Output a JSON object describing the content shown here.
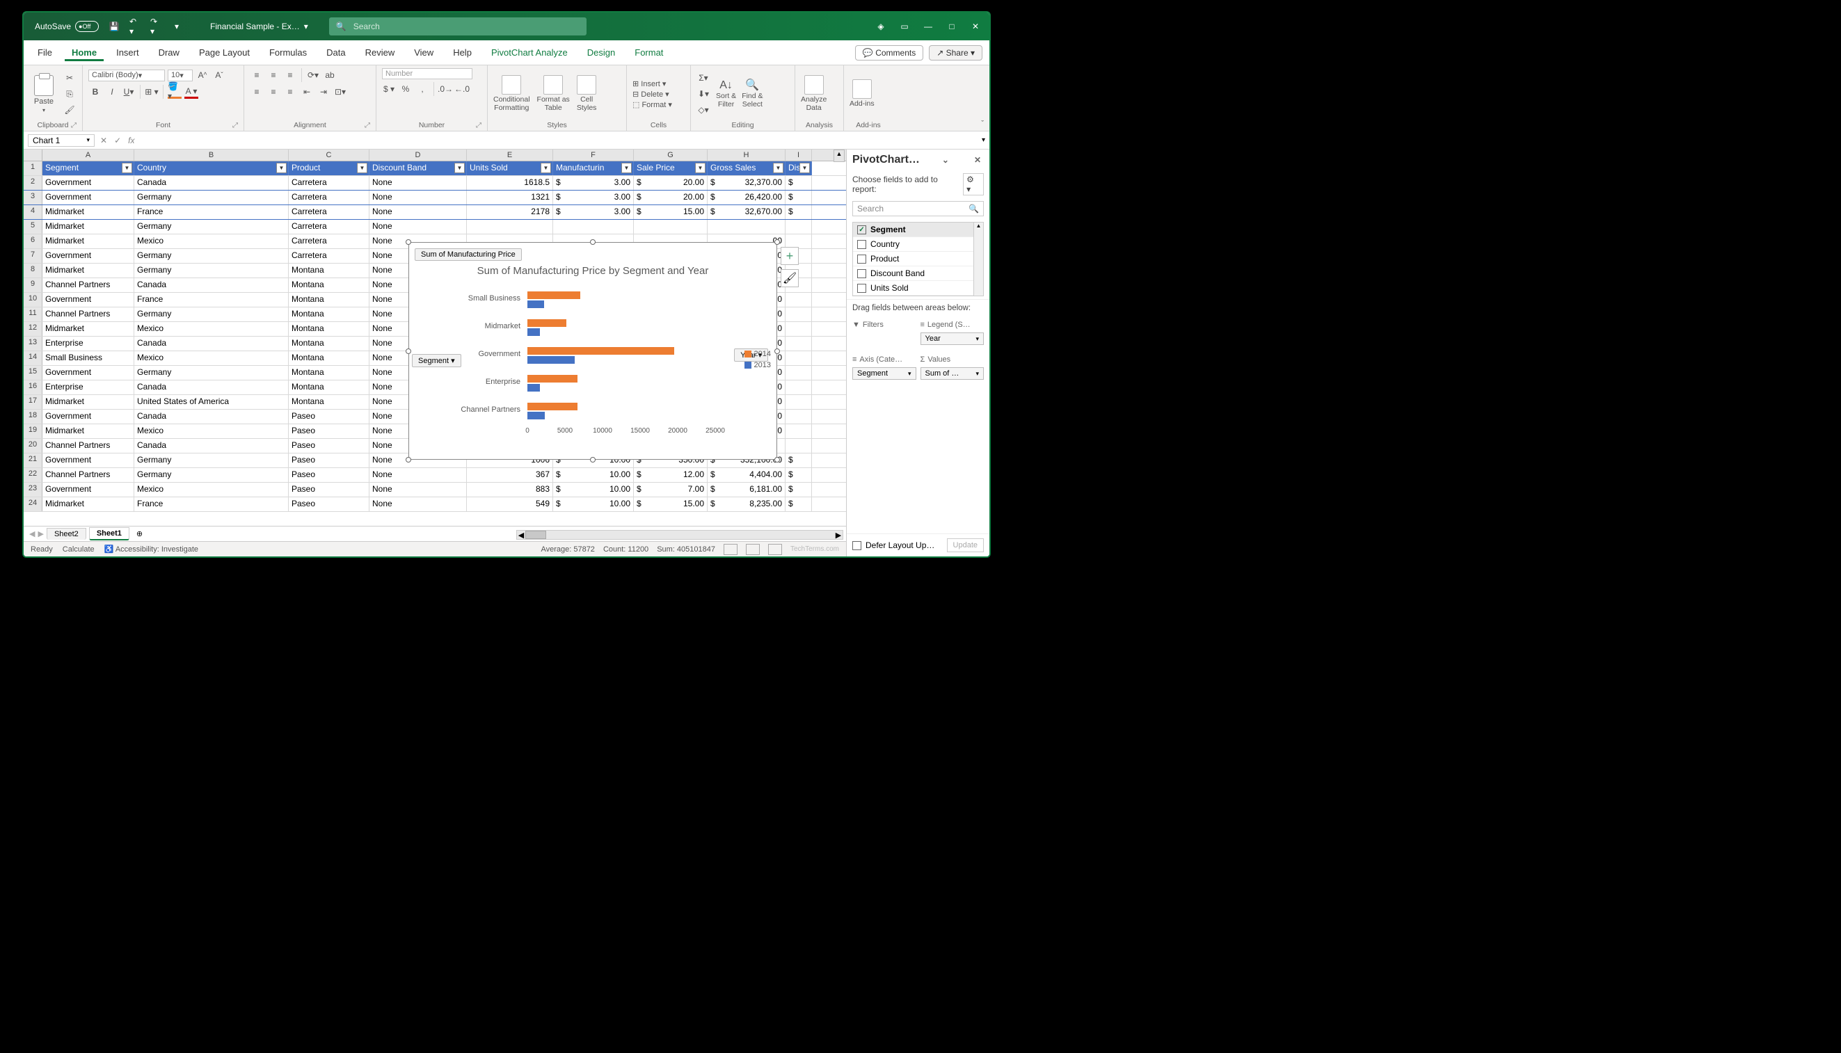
{
  "titlebar": {
    "autosave_label": "AutoSave",
    "autosave_state": "Off",
    "doc_title": "Financial Sample  -  Ex…",
    "search_placeholder": "Search"
  },
  "tabs": [
    "File",
    "Home",
    "Insert",
    "Draw",
    "Page Layout",
    "Formulas",
    "Data",
    "Review",
    "View",
    "Help",
    "PivotChart Analyze",
    "Design",
    "Format"
  ],
  "active_tab": "Home",
  "comments_label": "Comments",
  "share_label": "Share",
  "ribbon": {
    "paste": "Paste",
    "font_name": "Calibri (Body)",
    "font_size": "10",
    "number_format": "Number",
    "cond_fmt": "Conditional\nFormatting",
    "fmt_table": "Format as\nTable",
    "cell_styles": "Cell\nStyles",
    "insert": "Insert",
    "delete": "Delete",
    "format": "Format",
    "sort_filter": "Sort &\nFilter",
    "find_select": "Find &\nSelect",
    "analyze": "Analyze\nData",
    "addins": "Add-ins",
    "groups": [
      "Clipboard",
      "Font",
      "Alignment",
      "Number",
      "Styles",
      "Cells",
      "Editing",
      "Analysis",
      "Add-ins"
    ]
  },
  "namebox": "Chart 1",
  "columns": [
    "A",
    "B",
    "C",
    "D",
    "E",
    "F",
    "G",
    "H",
    "I"
  ],
  "headers": [
    "Segment",
    "Country",
    "Product",
    "Discount Band",
    "Units Sold",
    "Manufacturin",
    "Sale Price",
    "Gross Sales",
    "Disc"
  ],
  "rows": [
    {
      "n": 1,
      "hdr": true
    },
    {
      "n": 2,
      "seg": "Government",
      "cty": "Canada",
      "prd": "Carretera",
      "db": "None",
      "us": "1618.5",
      "doll": "$",
      "mp": "3.00",
      "sp": "20.00",
      "gs": "32,370.00"
    },
    {
      "n": 3,
      "seg": "Government",
      "cty": "Germany",
      "prd": "Carretera",
      "db": "None",
      "us": "1321",
      "doll": "$",
      "mp": "3.00",
      "sp": "20.00",
      "gs": "26,420.00"
    },
    {
      "n": 4,
      "seg": "Midmarket",
      "cty": "France",
      "prd": "Carretera",
      "db": "None",
      "us": "2178",
      "doll": "$",
      "mp": "3.00",
      "sp": "15.00",
      "gs": "32,670.00"
    },
    {
      "n": 5,
      "seg": "Midmarket",
      "cty": "Germany",
      "prd": "Carretera",
      "db": "None",
      "us": "",
      "doll": "",
      "mp": "",
      "sp": "",
      "gs": ""
    },
    {
      "n": 6,
      "seg": "Midmarket",
      "cty": "Mexico",
      "prd": "Carretera",
      "db": "None",
      "us": "",
      "doll": "",
      "mp": "",
      "sp": "",
      "gs": "00"
    },
    {
      "n": 7,
      "seg": "Government",
      "cty": "Germany",
      "prd": "Carretera",
      "db": "None",
      "us": "",
      "doll": "",
      "mp": "",
      "sp": "",
      "gs": "00"
    },
    {
      "n": 8,
      "seg": "Midmarket",
      "cty": "Germany",
      "prd": "Montana",
      "db": "None",
      "us": "",
      "doll": "",
      "mp": "",
      "sp": "",
      "gs": "00"
    },
    {
      "n": 9,
      "seg": "Channel Partners",
      "cty": "Canada",
      "prd": "Montana",
      "db": "None",
      "us": "",
      "doll": "",
      "mp": "",
      "sp": "",
      "gs": "00"
    },
    {
      "n": 10,
      "seg": "Government",
      "cty": "France",
      "prd": "Montana",
      "db": "None",
      "us": "",
      "doll": "",
      "mp": "",
      "sp": "",
      "gs": "00"
    },
    {
      "n": 11,
      "seg": "Channel Partners",
      "cty": "Germany",
      "prd": "Montana",
      "db": "None",
      "us": "",
      "doll": "",
      "mp": "",
      "sp": "",
      "gs": "00"
    },
    {
      "n": 12,
      "seg": "Midmarket",
      "cty": "Mexico",
      "prd": "Montana",
      "db": "None",
      "us": "",
      "doll": "",
      "mp": "",
      "sp": "",
      "gs": "00"
    },
    {
      "n": 13,
      "seg": "Enterprise",
      "cty": "Canada",
      "prd": "Montana",
      "db": "None",
      "us": "",
      "doll": "",
      "mp": "",
      "sp": "",
      "gs": "50"
    },
    {
      "n": 14,
      "seg": "Small Business",
      "cty": "Mexico",
      "prd": "Montana",
      "db": "None",
      "us": "",
      "doll": "",
      "mp": "",
      "sp": "",
      "gs": "00"
    },
    {
      "n": 15,
      "seg": "Government",
      "cty": "Germany",
      "prd": "Montana",
      "db": "None",
      "us": "",
      "doll": "",
      "mp": "",
      "sp": "",
      "gs": "00"
    },
    {
      "n": 16,
      "seg": "Enterprise",
      "cty": "Canada",
      "prd": "Montana",
      "db": "None",
      "us": "",
      "doll": "",
      "mp": "",
      "sp": "",
      "gs": "00"
    },
    {
      "n": 17,
      "seg": "Midmarket",
      "cty": "United States of America",
      "prd": "Montana",
      "db": "None",
      "us": "",
      "doll": "",
      "mp": "",
      "sp": "",
      "gs": "00"
    },
    {
      "n": 18,
      "seg": "Government",
      "cty": "Canada",
      "prd": "Paseo",
      "db": "None",
      "us": "",
      "doll": "",
      "mp": "",
      "sp": "",
      "gs": "00"
    },
    {
      "n": 19,
      "seg": "Midmarket",
      "cty": "Mexico",
      "prd": "Paseo",
      "db": "None",
      "us": "",
      "doll": "",
      "mp": "",
      "sp": "",
      "gs": "00"
    },
    {
      "n": 20,
      "seg": "Channel Partners",
      "cty": "Canada",
      "prd": "Paseo",
      "db": "None",
      "us": "",
      "doll": "",
      "mp": "",
      "sp": "",
      "gs": ""
    },
    {
      "n": 21,
      "seg": "Government",
      "cty": "Germany",
      "prd": "Paseo",
      "db": "None",
      "us": "1006",
      "doll": "$",
      "mp": "10.00",
      "sp": "350.00",
      "gs": "352,100.00"
    },
    {
      "n": 22,
      "seg": "Channel Partners",
      "cty": "Germany",
      "prd": "Paseo",
      "db": "None",
      "us": "367",
      "doll": "$",
      "mp": "10.00",
      "sp": "12.00",
      "gs": "4,404.00"
    },
    {
      "n": 23,
      "seg": "Government",
      "cty": "Mexico",
      "prd": "Paseo",
      "db": "None",
      "us": "883",
      "doll": "$",
      "mp": "10.00",
      "sp": "7.00",
      "gs": "6,181.00"
    },
    {
      "n": 24,
      "seg": "Midmarket",
      "cty": "France",
      "prd": "Paseo",
      "db": "None",
      "us": "549",
      "doll": "$",
      "mp": "10.00",
      "sp": "15.00",
      "gs": "8,235.00"
    }
  ],
  "chart": {
    "pill_sum": "Sum of Manufacturing Price",
    "pill_segment": "Segment",
    "pill_year": "Year",
    "title": "Sum of Manufacturing Price by Segment and Year"
  },
  "chart_data": {
    "type": "bar",
    "orientation": "horizontal",
    "categories": [
      "Small Business",
      "Midmarket",
      "Government",
      "Enterprise",
      "Channel Partners"
    ],
    "series": [
      {
        "name": "2014",
        "values": [
          7000,
          5200,
          19500,
          6700,
          6700
        ]
      },
      {
        "name": "2013",
        "values": [
          2200,
          1700,
          6300,
          1700,
          2300
        ]
      }
    ],
    "xlim": [
      0,
      25000
    ],
    "xticks": [
      0,
      5000,
      10000,
      15000,
      20000,
      25000
    ],
    "legend_position": "right",
    "colors": {
      "2014": "#ed7d31",
      "2013": "#4472c4"
    }
  },
  "sheet_tabs": [
    "Sheet2",
    "Sheet1"
  ],
  "active_sheet": "Sheet1",
  "status": {
    "ready": "Ready",
    "calc": "Calculate",
    "access": "Accessibility: Investigate",
    "avg": "Average: 57872",
    "count": "Count: 11200",
    "sum": "Sum: 405101847",
    "watermark": "TechTerms.com"
  },
  "pivot": {
    "title": "PivotChart…",
    "subtitle": "Choose fields to add to report:",
    "search": "Search",
    "fields": [
      {
        "label": "Segment",
        "checked": true
      },
      {
        "label": "Country",
        "checked": false
      },
      {
        "label": "Product",
        "checked": false
      },
      {
        "label": "Discount Band",
        "checked": false
      },
      {
        "label": "Units Sold",
        "checked": false
      }
    ],
    "drag_label": "Drag fields between areas below:",
    "areas": {
      "filters": "Filters",
      "legend": "Legend (S…",
      "axis": "Axis (Cate…",
      "values": "Values"
    },
    "pills": {
      "legend": "Year",
      "axis": "Segment",
      "values": "Sum of …"
    },
    "defer": "Defer Layout Up…",
    "update": "Update"
  }
}
